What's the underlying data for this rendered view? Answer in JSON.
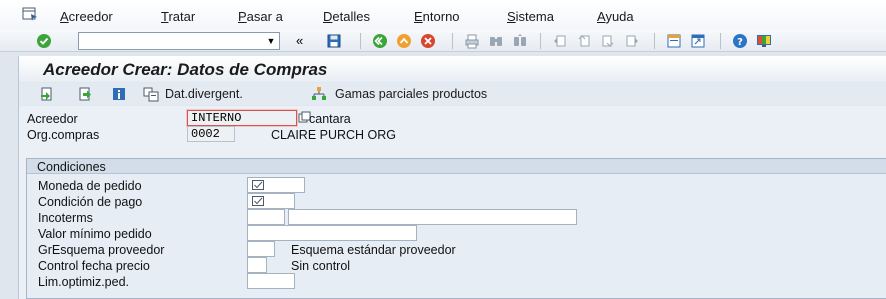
{
  "menu": {
    "items": [
      {
        "label": "Acreedor",
        "ul": "A"
      },
      {
        "label": "Tratar",
        "ul": "T"
      },
      {
        "label": "Pasar a",
        "ul": "P"
      },
      {
        "label": "Detalles",
        "ul": "D"
      },
      {
        "label": "Entorno",
        "ul": "E"
      },
      {
        "label": "Sistema",
        "ul": "S"
      },
      {
        "label": "Ayuda",
        "ul": "A"
      }
    ]
  },
  "toolbar": {
    "command_value": "",
    "back_glyph": "«"
  },
  "page": {
    "title": "Acreedor Crear: Datos de Compras"
  },
  "app_toolbar": {
    "dat_divergent_label": "Dat.divergent.",
    "gamas_label": "Gamas parciales productos"
  },
  "header_fields": {
    "acreedor_label": "Acreedor",
    "acreedor_value": "INTERNO",
    "acreedor_desc": "cantara",
    "orgcompras_label": "Org.compras",
    "orgcompras_value": "0002",
    "orgcompras_desc": "CLAIRE PURCH ORG"
  },
  "condiciones": {
    "title": "Condiciones",
    "moneda_label": "Moneda de pedido",
    "moneda_value": "",
    "condicion_label": "Condición de pago",
    "condicion_value": "",
    "incoterms_label": "Incoterms",
    "incoterms_value1": "",
    "incoterms_value2": "",
    "valor_label": "Valor mínimo pedido",
    "valor_value": "",
    "gresquema_label": "GrEsquema proveedor",
    "gresquema_value": "",
    "gresquema_desc": "Esquema estándar proveedor",
    "control_label": "Control fecha precio",
    "control_value": "",
    "control_desc": "Sin control",
    "lim_label": "Lim.optimiz.ped.",
    "lim_value": ""
  },
  "colors": {
    "enter_green": "#3aa53a",
    "cancel_red": "#d9462f",
    "exit_orange": "#f0a030",
    "help_blue": "#2b74c7"
  }
}
